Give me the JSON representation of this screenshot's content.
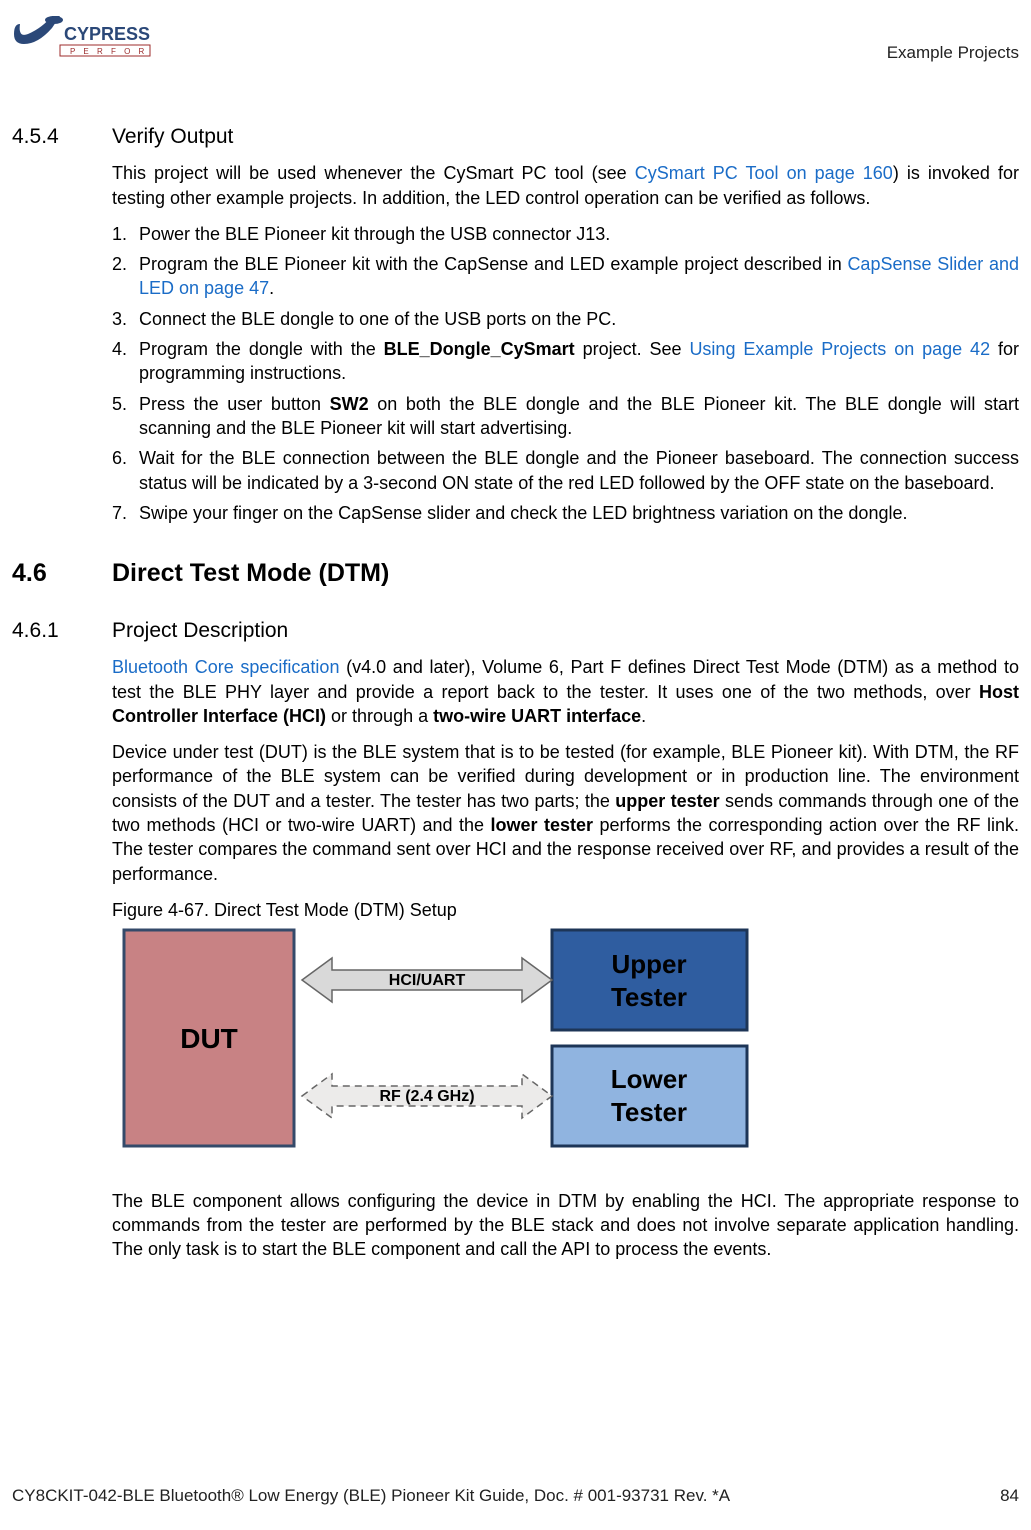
{
  "header": {
    "logo_top": "CYPRESS",
    "logo_sub": "P E R F O R M",
    "right_text": "Example Projects"
  },
  "s454": {
    "num": "4.5.4",
    "title": "Verify Output",
    "intro_a": "This project will be used whenever the CySmart PC tool (see ",
    "intro_link1": "CySmart PC Tool on page 160",
    "intro_b": ") is invoked for testing other example projects. In addition, the LED control operation can be verified as follows.",
    "steps": [
      {
        "n": "1.",
        "t": "Power the BLE Pioneer kit through the USB connector J13."
      },
      {
        "n": "2.",
        "t_a": "Program the BLE Pioneer kit with the CapSense and LED example project described in ",
        "link": "CapSense Slider and LED on page 47",
        "t_b": "."
      },
      {
        "n": "3.",
        "t": "Connect the BLE dongle to one of the USB ports on the PC."
      },
      {
        "n": "4.",
        "t_a": "Program the dongle with the ",
        "bold": "BLE_Dongle_CySmart",
        "t_b": " project. See ",
        "link": "Using Example Projects on page 42",
        "t_c": " for programming instructions."
      },
      {
        "n": "5.",
        "t_a": "Press the user button ",
        "bold": "SW2",
        "t_b": " on both the BLE dongle and the BLE Pioneer kit. The BLE dongle will start scanning and the BLE Pioneer kit will start advertising."
      },
      {
        "n": "6.",
        "t": "Wait for the BLE connection between the BLE dongle and the Pioneer baseboard. The connection success status will be indicated by a 3-second ON state of the red LED followed by the OFF state on the baseboard."
      },
      {
        "n": "7.",
        "t": "Swipe your finger on the CapSense slider and check the LED brightness variation on the dongle."
      }
    ]
  },
  "s46": {
    "num": "4.6",
    "title": "Direct Test Mode (DTM)"
  },
  "s461": {
    "num": "4.6.1",
    "title": "Project Description",
    "p1_link": "Bluetooth Core specification",
    "p1_a": " (v4.0 and later), Volume 6, Part F defines Direct Test Mode (DTM) as a method to test the BLE PHY layer and provide a report back to the tester. It uses one of the two methods, over ",
    "p1_b1": "Host Controller Interface (HCI)",
    "p1_b": " or through a ",
    "p1_b2": "two-wire UART interface",
    "p1_c": ".",
    "p2_a": "Device under test (DUT) is the BLE system that is to be tested (for example, BLE Pioneer kit). With DTM, the RF performance of the BLE system can be verified during development or in production line. The environment consists of the DUT and a tester. The tester has two parts; the ",
    "p2_b1": "upper tester",
    "p2_b": " sends commands through one of the two methods (HCI or two-wire UART) and the ",
    "p2_b2": "lower tester",
    "p2_c": " performs the corresponding action over the RF link. The tester compares the command sent over HCI and the response received over RF, and provides a result of the performance.",
    "fig_caption": "Figure 4-67.  Direct Test Mode (DTM) Setup",
    "diagram": {
      "dut": "DUT",
      "arrow1": "HCI/UART",
      "arrow2": "RF (2.4 GHz)",
      "upper_line1": "Upper",
      "upper_line2": "Tester",
      "lower_line1": "Lower",
      "lower_line2": "Tester"
    },
    "p3": "The BLE component allows configuring the device in DTM by enabling the HCI. The appropriate response to commands from the tester are performed by the BLE stack and does not involve separate application handling. The only task is to start the BLE component and call the API to process the events."
  },
  "footer": {
    "left": "CY8CKIT-042-BLE Bluetooth® Low Energy (BLE) Pioneer Kit Guide, Doc. # 001-93731 Rev. *A",
    "right": "84"
  }
}
